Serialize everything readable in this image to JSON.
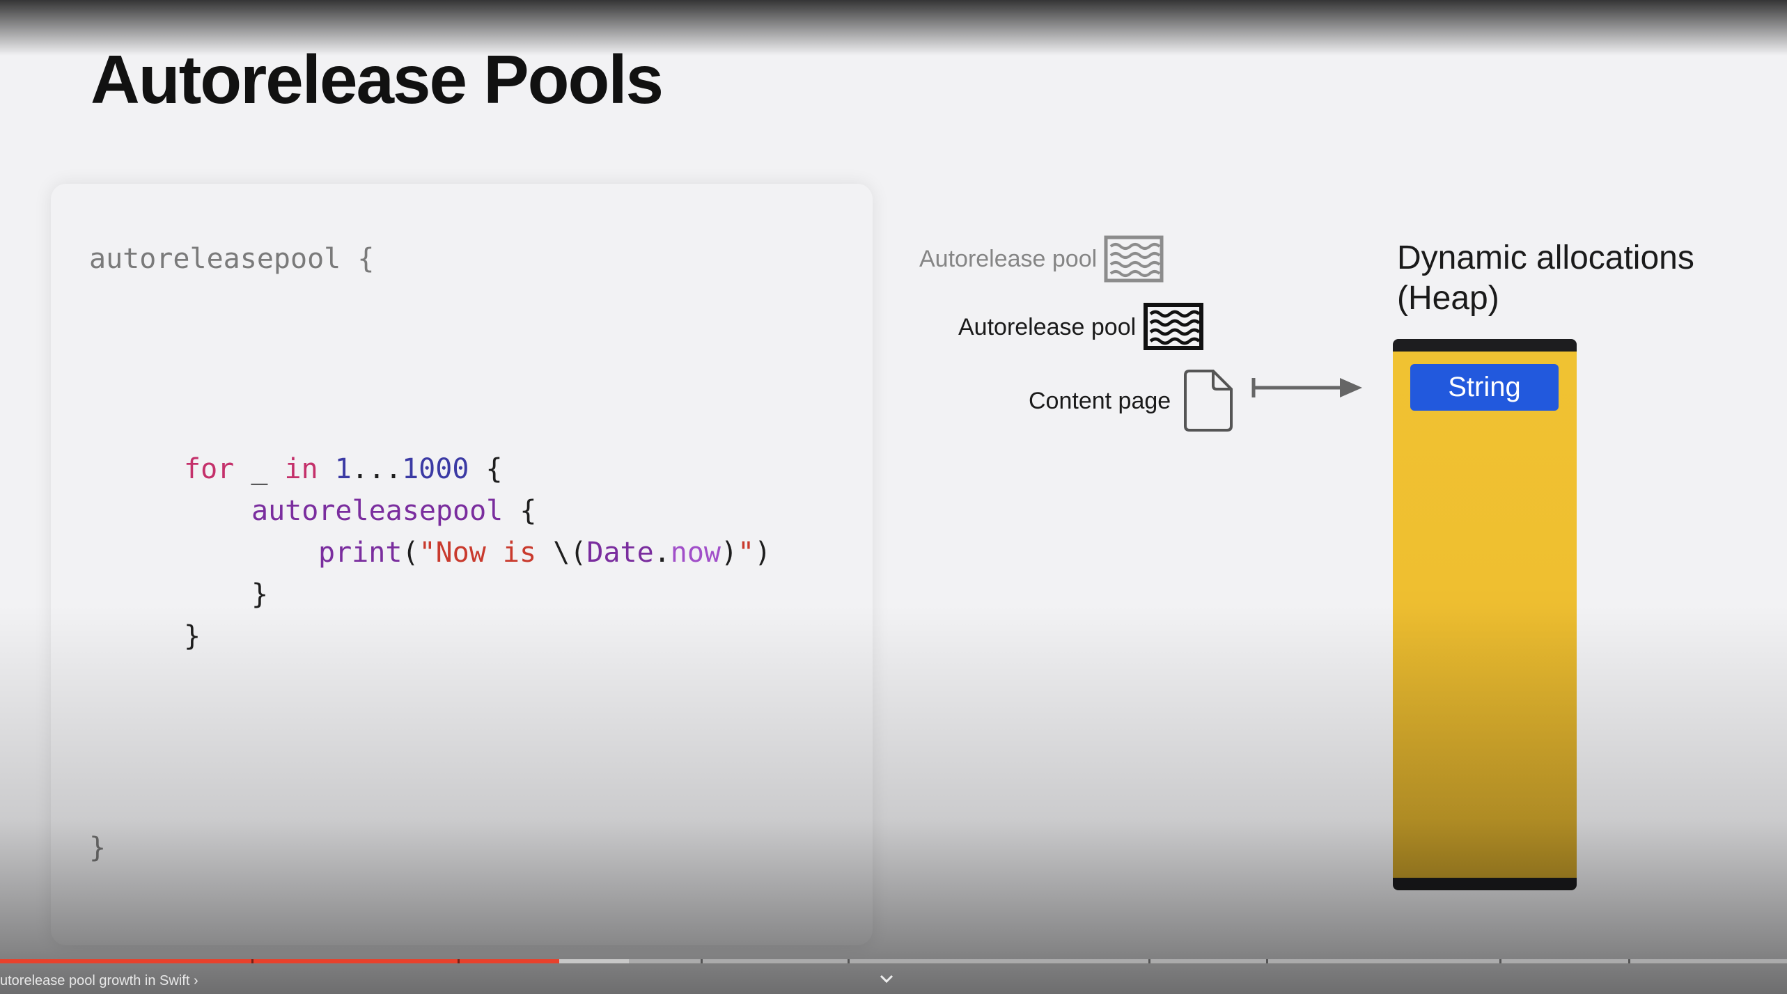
{
  "slide": {
    "title": "Autorelease Pools"
  },
  "code": {
    "outer_open": "autoreleasepool {",
    "for_keyword": "for",
    "for_var": " _ ",
    "in_keyword": "in",
    "range_start": " 1",
    "range_op": "...",
    "range_end": "1000",
    "for_brace": " {",
    "inner_open_name": "autoreleasepool",
    "inner_open_brace": " {",
    "print_fn": "print",
    "print_paren": "(",
    "string_open": "\"Now is",
    "interp_open": " \\(",
    "date_type": "Date",
    "dot": ".",
    "now_prop": "now",
    "interp_close": ")",
    "string_close": "\"",
    "print_close": ")",
    "inner_close": "}",
    "for_close": "}",
    "outer_close": "}"
  },
  "diagram": {
    "outer_pool_label": "Autorelease pool",
    "inner_pool_label": "Autorelease pool",
    "page_label": "Content page",
    "heap_title_line1": "Dynamic allocations",
    "heap_title_line2": "(Heap)",
    "heap_item": "String",
    "colors": {
      "heap_fill": "#f0c232",
      "heap_border": "#1d1d1f",
      "string_chip": "#2259dd"
    },
    "icons": [
      "pool-icon",
      "page-icon",
      "arrow-icon"
    ]
  },
  "player": {
    "chapter_label": "utorelease pool growth in Swift",
    "chapter_chevron": "›",
    "progress_color": "#e8412c",
    "buffered_color": "#c8c8c8"
  }
}
